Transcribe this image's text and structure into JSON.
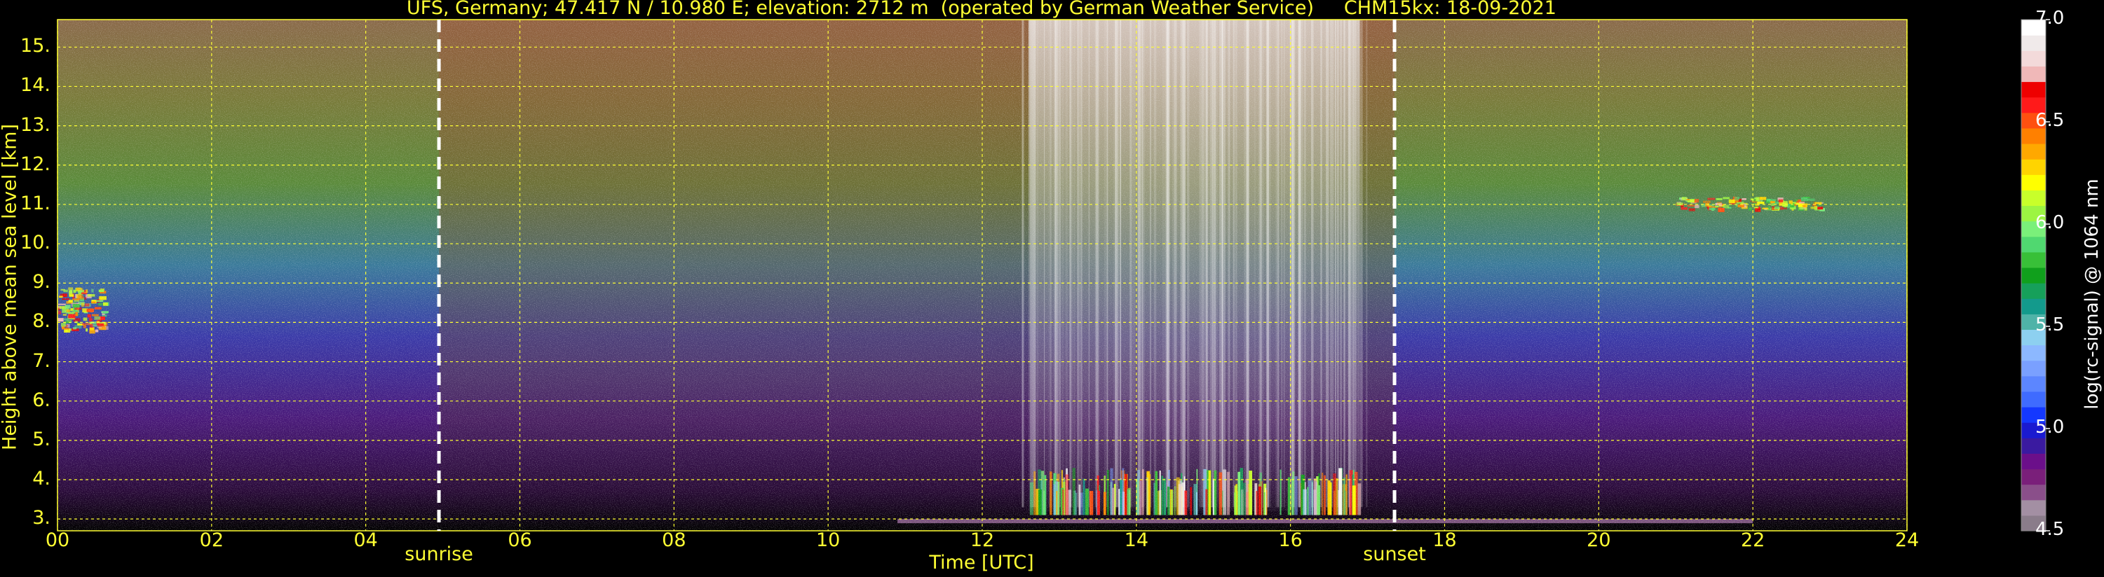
{
  "title": "UFS, Germany; 47.417 N / 10.980 E; elevation: 2712 m  (operated by German Weather Service)     CHM15kx: 18-09-2021",
  "chart_data": {
    "type": "heatmap",
    "title": "UFS, Germany; 47.417 N / 10.980 E; elevation: 2712 m  (operated by German Weather Service)     CHM15kx: 18-09-2021",
    "xlabel": "Time [UTC]",
    "ylabel": "Height above mean sea level [km]",
    "xlim": [
      0,
      24
    ],
    "ylim": [
      2.7,
      15.7
    ],
    "x_ticks": [
      "00",
      "02",
      "04",
      "06",
      "08",
      "10",
      "12",
      "14",
      "16",
      "18",
      "20",
      "22",
      "24"
    ],
    "y_ticks": [
      "3.",
      "4.",
      "5.",
      "6.",
      "7.",
      "8.",
      "9.",
      "10.",
      "11.",
      "12.",
      "13.",
      "14.",
      "15."
    ],
    "grid": true,
    "colorbar": {
      "label": "log(rc-signal) @ 1064 nm",
      "range": [
        4.5,
        7.0
      ],
      "ticks": [
        "4.5",
        "5.0",
        "5.5",
        "6.0",
        "6.5",
        "7.0"
      ],
      "colors": [
        "#8a7c8a",
        "#a38fa3",
        "#8a4f8a",
        "#7a1f7a",
        "#6b0f8a",
        "#3a1aa0",
        "#1a1ad0",
        "#1438ff",
        "#3f6bff",
        "#5c86ff",
        "#7aa0ff",
        "#8cb8ff",
        "#8dd0f0",
        "#4fb3a8",
        "#139a8c",
        "#16a05a",
        "#10a01c",
        "#38c038",
        "#50d870",
        "#7af07a",
        "#9cf542",
        "#c8ff2a",
        "#ffff00",
        "#ffd400",
        "#ffa800",
        "#ff8000",
        "#ff5010",
        "#ff1a1a",
        "#ee0000",
        "#f0b8b8",
        "#f3dada",
        "#f0eaea",
        "#ffffff"
      ]
    },
    "events": [
      {
        "label": "sunrise",
        "time": 4.95
      },
      {
        "label": "sunset",
        "time": 17.35
      }
    ],
    "features": [
      {
        "description": "cloud layer",
        "time_range": [
          0.0,
          0.6
        ],
        "height_range": [
          7.8,
          8.9
        ]
      },
      {
        "description": "cirrus",
        "time_range": [
          21.0,
          22.9
        ],
        "height_range": [
          10.9,
          11.2
        ]
      },
      {
        "description": "boundary layer convection",
        "time_range": [
          12.6,
          16.9
        ],
        "height_range": [
          3.1,
          4.3
        ]
      }
    ]
  }
}
